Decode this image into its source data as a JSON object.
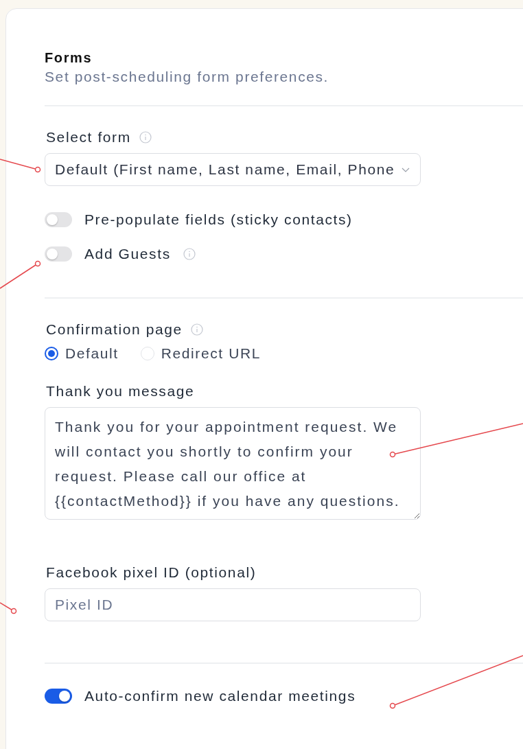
{
  "section": {
    "title": "Forms",
    "subtitle": "Set post-scheduling form preferences."
  },
  "select_form": {
    "label": "Select form",
    "value": "Default (First name, Last name, Email, Phone"
  },
  "toggles": [
    {
      "label": "Pre-populate fields (sticky contacts)",
      "on": false,
      "info": false
    },
    {
      "label": "Add Guests",
      "on": false,
      "info": true
    }
  ],
  "confirmation_page": {
    "label": "Confirmation page",
    "options": [
      {
        "label": "Default",
        "selected": true
      },
      {
        "label": "Redirect URL",
        "selected": false
      }
    ]
  },
  "thank_you_message": {
    "label": "Thank you message",
    "value": "Thank you for your appointment request. We will contact you shortly to confirm your request. Please call our office at {{contactMethod}} if you have any questions."
  },
  "facebook_pixel": {
    "label": "Facebook pixel ID (optional)",
    "placeholder": "Pixel ID"
  },
  "auto_confirm": {
    "label": "Auto-confirm new calendar meetings",
    "on": true
  }
}
